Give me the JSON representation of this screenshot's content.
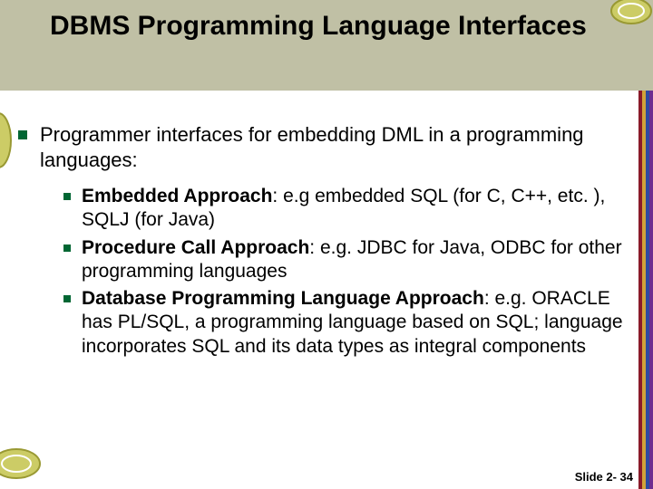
{
  "title": "DBMS Programming Language Interfaces",
  "main_bullet": "Programmer interfaces for embedding DML in a programming languages:",
  "sub_bullets": [
    {
      "lead": "Embedded Approach",
      "rest": ": e.g embedded SQL (for C, C++, etc. ), SQLJ (for Java)"
    },
    {
      "lead": "Procedure Call Approach",
      "rest": ": e.g. JDBC for Java, ODBC for other programming languages"
    },
    {
      "lead": "Database Programming Language Approach",
      "rest": ": e.g. ORACLE has PL/SQL, a programming language based on SQL; language incorporates SQL and its data types as integral components"
    }
  ],
  "footer": "Slide 2- 34"
}
